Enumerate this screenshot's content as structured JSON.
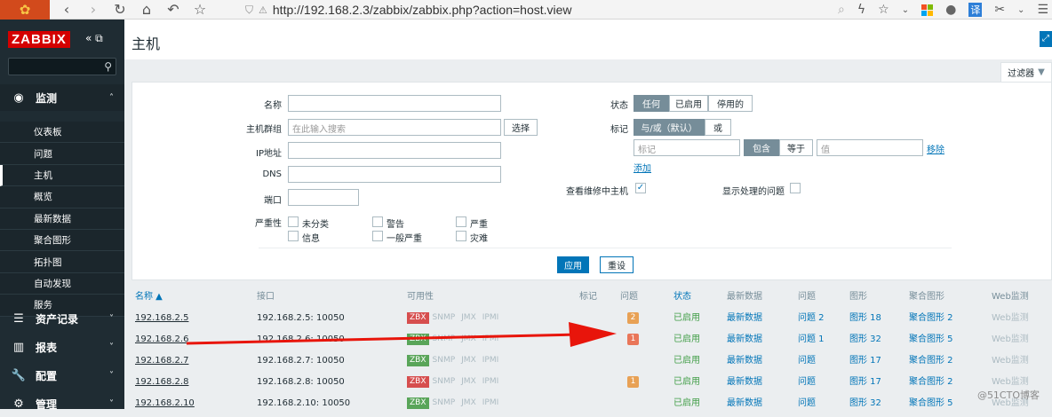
{
  "browser": {
    "url": "http://192.168.2.3/zabbix/zabbix.php?action=host.view",
    "translate": "译"
  },
  "sidebar": {
    "logo": "ZABBIX",
    "sections": [
      {
        "icon": "eye-icon",
        "label": "监测",
        "expanded": true
      },
      {
        "icon": "list-icon",
        "label": "资产记录"
      },
      {
        "icon": "chart-icon",
        "label": "报表"
      },
      {
        "icon": "wrench-icon",
        "label": "配置"
      },
      {
        "icon": "gear-icon",
        "label": "管理"
      }
    ],
    "monitoring_items": [
      "仪表板",
      "问题",
      "主机",
      "概览",
      "最新数据",
      "聚合图形",
      "拓扑图",
      "自动发现",
      "服务"
    ],
    "active_item": "主机"
  },
  "page": {
    "title": "主机",
    "filter_tab": "过滤器"
  },
  "filter": {
    "name_label": "名称",
    "hostgroup_label": "主机群组",
    "hostgroup_placeholder": "在此输入搜索",
    "select_button": "选择",
    "ip_label": "IP地址",
    "dns_label": "DNS",
    "port_label": "端口",
    "severity_label": "严重性",
    "severities": [
      "未分类",
      "警告",
      "严重",
      "信息",
      "一般严重",
      "灾难"
    ],
    "status_label": "状态",
    "status_options": [
      "任何",
      "已启用",
      "停用的"
    ],
    "tags_label": "标记",
    "tag_mode": [
      "与/或（默认）",
      "或"
    ],
    "tag_placeholder": "标记",
    "tag_ops": [
      "包含",
      "等于"
    ],
    "value_placeholder": "值",
    "remove_link": "移除",
    "add_link": "添加",
    "maintenance_label": "查看维修中主机",
    "show_suppressed_label": "显示处理的问题",
    "apply_button": "应用",
    "reset_button": "重设"
  },
  "table": {
    "headers": [
      "名称 ▲",
      "接口",
      "可用性",
      "标记",
      "问题",
      "状态",
      "最新数据",
      "问题",
      "图形",
      "聚合图形",
      "Web监测"
    ],
    "rows": [
      {
        "name": "192.168.2.5",
        "interface": "192.168.2.5: 10050",
        "zbx": "red",
        "problems": "2",
        "status": "已启用",
        "latest": "最新数据",
        "problem_link": "问题 2",
        "graphs": "图形 18",
        "screens": "聚合图形 2",
        "web": "Web监测"
      },
      {
        "name": "192.168.2.6",
        "interface": "192.168.2.6: 10050",
        "zbx": "green",
        "problems": "1",
        "status": "已启用",
        "latest": "最新数据",
        "problem_link": "问题 1",
        "graphs": "图形 32",
        "screens": "聚合图形 5",
        "web": "Web监测"
      },
      {
        "name": "192.168.2.7",
        "interface": "192.168.2.7: 10050",
        "zbx": "green",
        "problems": "",
        "status": "已启用",
        "latest": "最新数据",
        "problem_link": "问题",
        "graphs": "图形 17",
        "screens": "聚合图形 2",
        "web": "Web监测"
      },
      {
        "name": "192.168.2.8",
        "interface": "192.168.2.8: 10050",
        "zbx": "red",
        "problems": "1",
        "status": "已启用",
        "latest": "最新数据",
        "problem_link": "问题",
        "graphs": "图形 17",
        "screens": "聚合图形 2",
        "web": "Web监测"
      },
      {
        "name": "192.168.2.10",
        "interface": "192.168.2.10: 10050",
        "zbx": "green",
        "problems": "",
        "status": "已启用",
        "latest": "最新数据",
        "problem_link": "问题",
        "graphs": "图形 32",
        "screens": "聚合图形 5",
        "web": "Web监测"
      }
    ],
    "availability_labels": [
      "ZBX",
      "SNMP",
      "JMX",
      "IPMI"
    ]
  },
  "watermark": "@51CTO博客",
  "colors": {
    "zbx_red": "#d64e4e",
    "zbx_green": "#59a559",
    "badge_warning": "#e8a155",
    "badge_high": "#e97659",
    "arrow": "#e8150b"
  }
}
